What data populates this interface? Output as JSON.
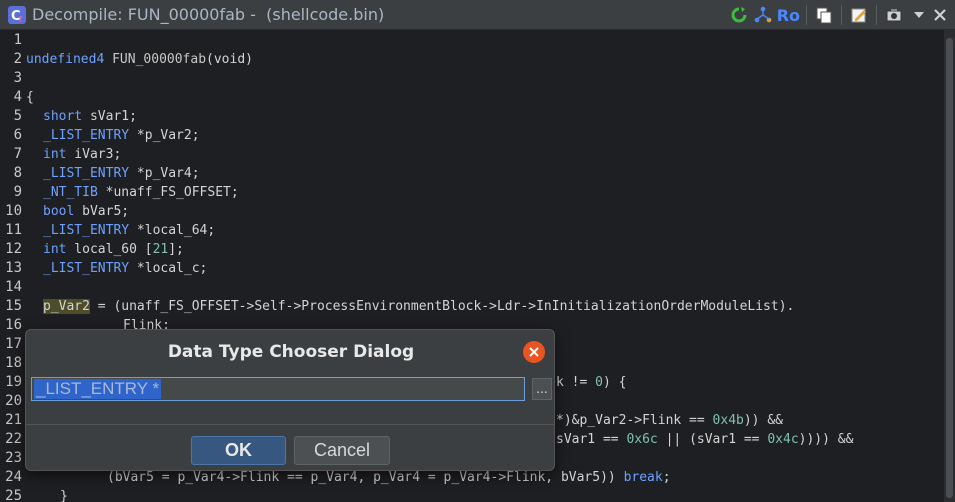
{
  "window": {
    "title": "Decompile: FUN_00000fab -  (shellcode.bin)",
    "ro_label": "Ro",
    "icons": [
      "decompiler-logo-icon",
      "refresh-icon",
      "graph-icon",
      "copy-icon",
      "edit-icon",
      "snapshot-icon",
      "dropdown-icon",
      "close-icon"
    ]
  },
  "editor": {
    "line_numbers": [
      "1",
      "2",
      "3",
      "4",
      "5",
      "6",
      "7",
      "8",
      "9",
      "10",
      "11",
      "12",
      "13",
      "14",
      "15",
      "16",
      "17",
      "18",
      "19",
      "20",
      "21",
      "22",
      "23",
      "24",
      "25"
    ],
    "lines": {
      "l2_type": "undefined4",
      "l2_name": "FUN_00000fab",
      "l2_rest": "(void)",
      "l4": "{",
      "l5_type": "short",
      "l5_rest": " sVar1;",
      "l6_type": "_LIST_ENTRY",
      "l6_rest": " *p_Var2;",
      "l7_type": "int",
      "l7_rest": " iVar3;",
      "l8_type": "_LIST_ENTRY",
      "l8_rest": " *p_Var4;",
      "l9_type": "_NT_TIB",
      "l9_rest": " *unaff_FS_OFFSET;",
      "l10_type": "bool",
      "l10_rest": " bVar5;",
      "l11_type": "_LIST_ENTRY",
      "l11_rest": " *local_64;",
      "l12_type": "int",
      "l12_rest1": " local_60 [",
      "l12_num": "21",
      "l12_rest2": "];",
      "l13_type": "_LIST_ENTRY",
      "l13_rest": " *local_c;",
      "l15_var": "p_Var2",
      "l15_rest": " = (unaff_FS_OFFSET->Self->ProcessEnvironmentBlock->Ldr->InInitializationOrderModuleList).",
      "l16": "Flink;",
      "l19_rest": "k != ",
      "l19_num": "0",
      "l19_end": ") {",
      "l21_a": "*)&p_Var2->Flink == ",
      "l21_num": "0x4b",
      "l21_b": ")) &&",
      "l22_a": "sVar1 == ",
      "l22_num1": "0x6c",
      "l22_b": " || (sVar1 == ",
      "l22_num2": "0x4c",
      "l22_c": ")))) &&",
      "l24_a": "(bVar5 = p_Var4->Flink == p_Var4, p_Var4 = p_Var4->Flink, bVar5)) ",
      "l24_kw": "break",
      "l24_b": ";",
      "l25": "}"
    }
  },
  "dialog": {
    "title": "Data Type Chooser Dialog",
    "input_value": "_LIST_ENTRY *",
    "more_button": "...",
    "ok_label": "OK",
    "cancel_label": "Cancel"
  },
  "colors": {
    "accent": "#6ea1ff",
    "close": "#e95420",
    "selection": "#2f65ca"
  }
}
